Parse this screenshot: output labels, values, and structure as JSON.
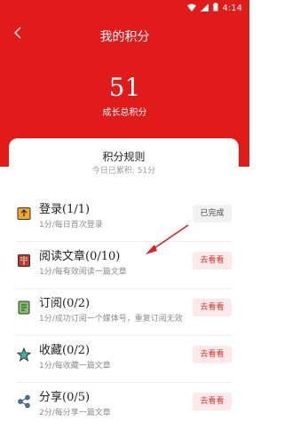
{
  "status_bar": {
    "time": "4:14"
  },
  "nav": {
    "title": "我的积分"
  },
  "score": {
    "value": "51",
    "label": "成长总积分"
  },
  "card": {
    "title": "积分规则",
    "subtitle": "今日已累积: 51分"
  },
  "rules": [
    {
      "title": "登录(1/1)",
      "desc": "1分/每日首次登录",
      "action": "已完成",
      "icon": "login-icon"
    },
    {
      "title": "阅读文章(0/10)",
      "desc": "1分/每有效阅读一篇文章",
      "action": "去看看",
      "icon": "book-icon"
    },
    {
      "title": "订阅(0/2)",
      "desc": "1分/成功订阅一个媒体号，重复订阅无效",
      "action": "去看看",
      "icon": "subscribe-icon"
    },
    {
      "title": "收藏(0/2)",
      "desc": "1分/每收藏一篇文章",
      "action": "去看看",
      "icon": "star-icon"
    },
    {
      "title": "分享(0/5)",
      "desc": "2分/每分享一篇文章",
      "action": "去看看",
      "icon": "share-icon"
    }
  ],
  "colors": {
    "header": "#e11a1a",
    "action_text": "#d9352d"
  }
}
